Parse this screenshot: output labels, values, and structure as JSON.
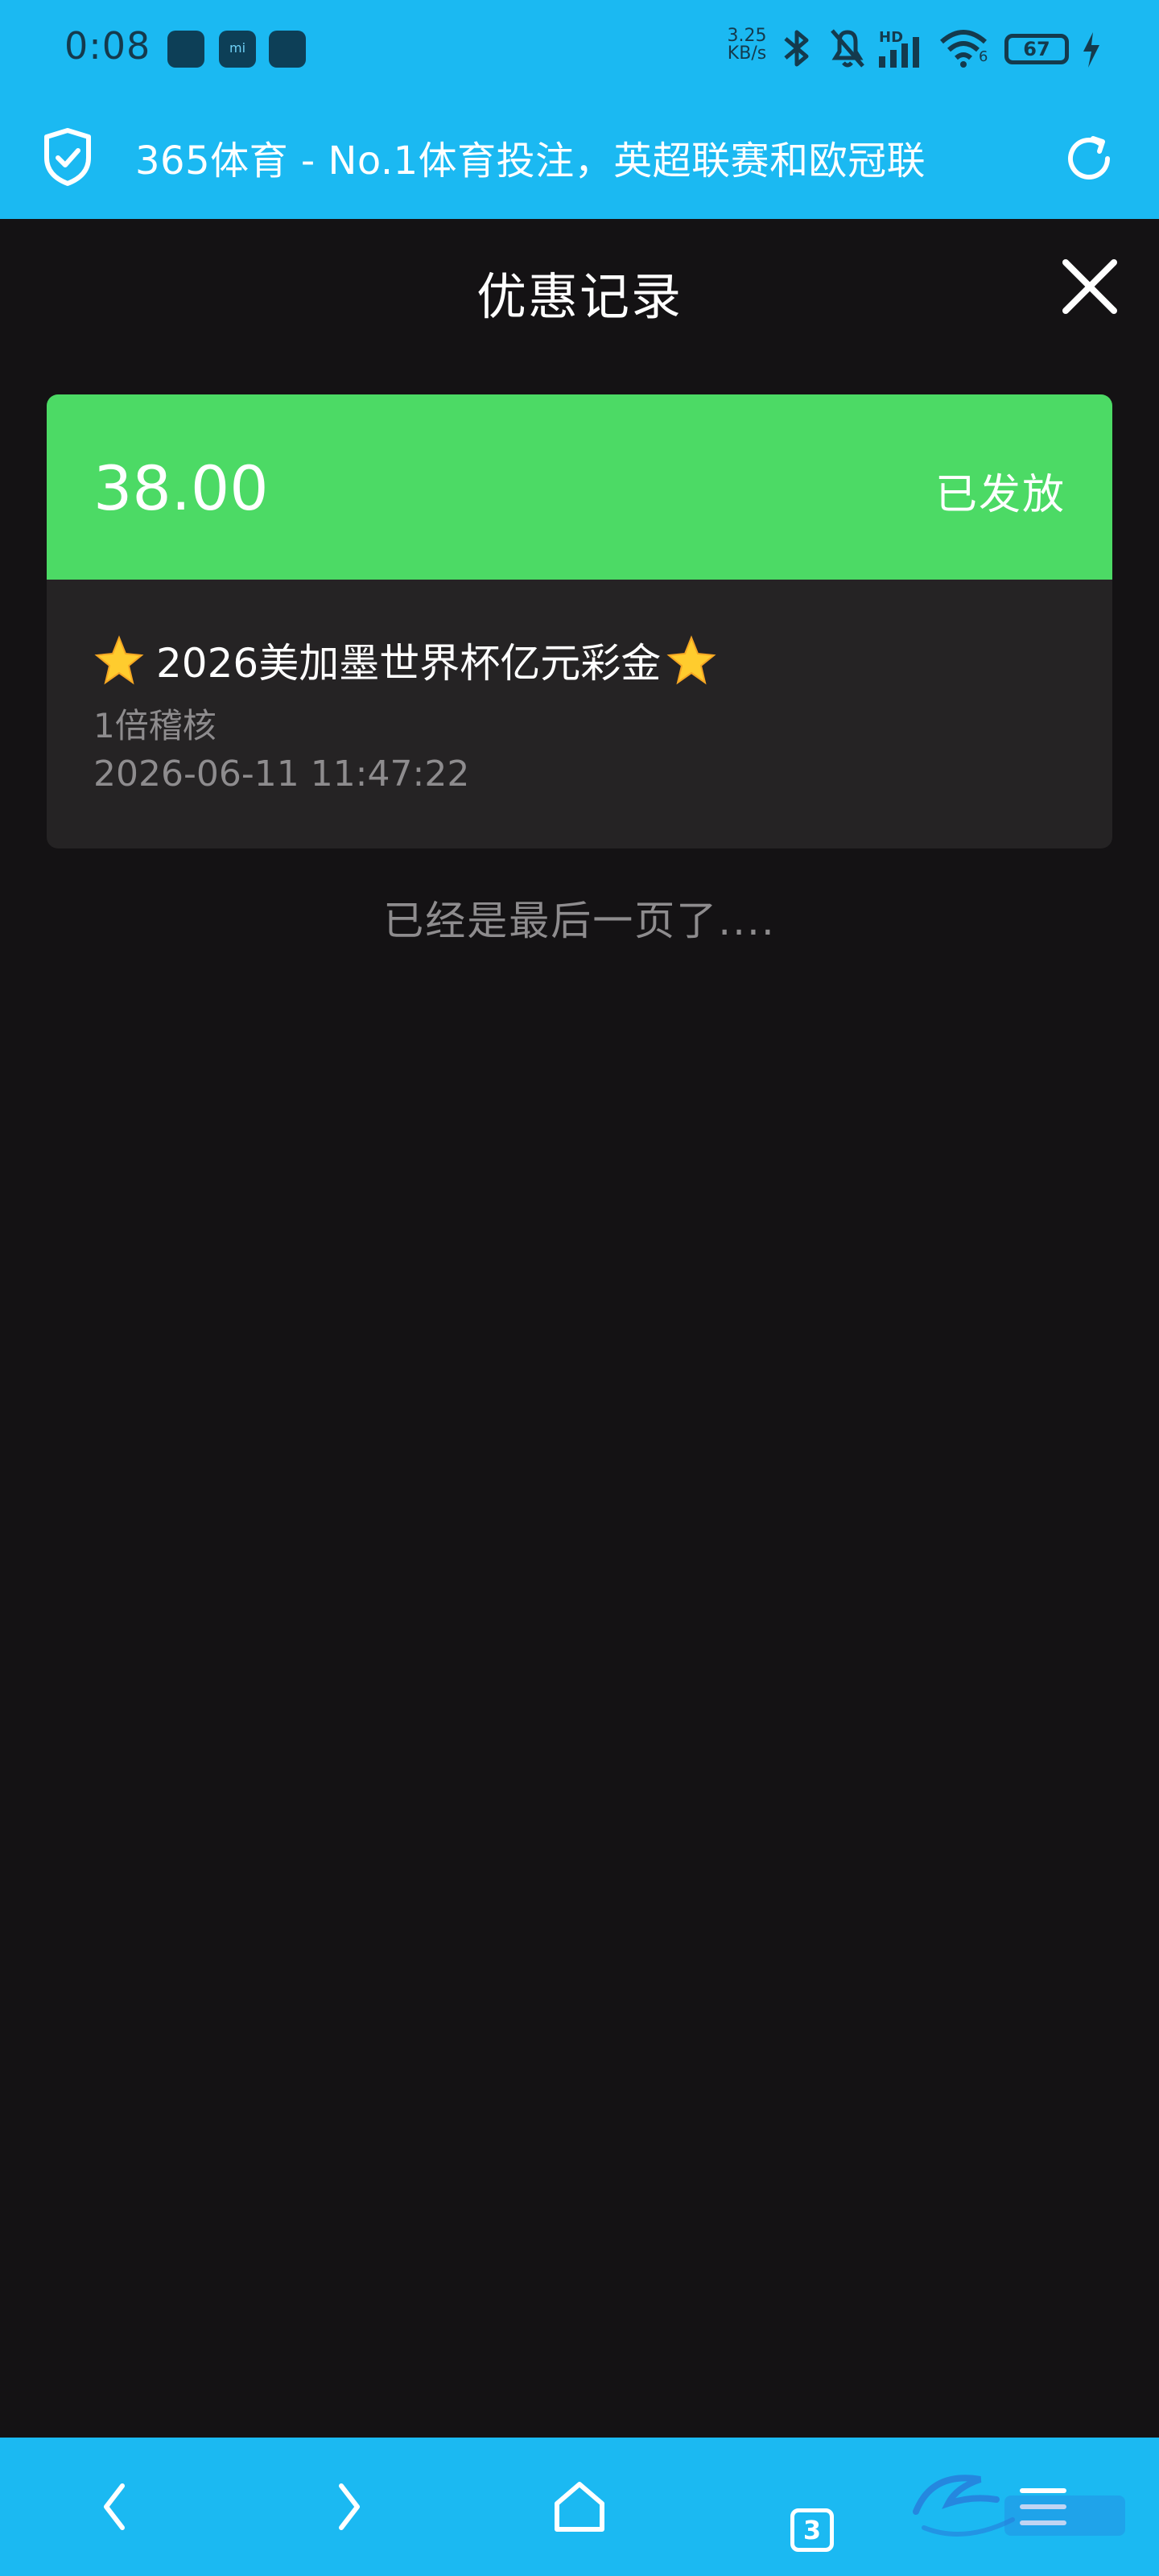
{
  "status_bar": {
    "time": "0:08",
    "net_speed_value": "3.25",
    "net_speed_unit": "KB/s",
    "network_label": "HD",
    "wifi_label": "6",
    "battery_level": "67"
  },
  "address_bar": {
    "url_title": "365体育 - No.1体育投注，英超联赛和欧冠联"
  },
  "modal": {
    "title": "优惠记录"
  },
  "record": {
    "amount": "38.00",
    "status": "已发放",
    "title": "2026美加墨世界杯亿元彩金",
    "subtitle": "1倍稽核",
    "time": "2026-06-11 11:47:22"
  },
  "list": {
    "end_text": "已经是最后一页了...."
  },
  "bottom_nav": {
    "tab_count": "3"
  },
  "colors": {
    "brand": "#1bb9f2",
    "status_green": "#4cda65",
    "background": "#141214",
    "card": "#252324"
  },
  "icons": [
    "shield-check-icon",
    "refresh-icon",
    "close-icon",
    "star-icon",
    "back-icon",
    "forward-icon",
    "home-icon",
    "tabs-icon",
    "menu-icon"
  ]
}
